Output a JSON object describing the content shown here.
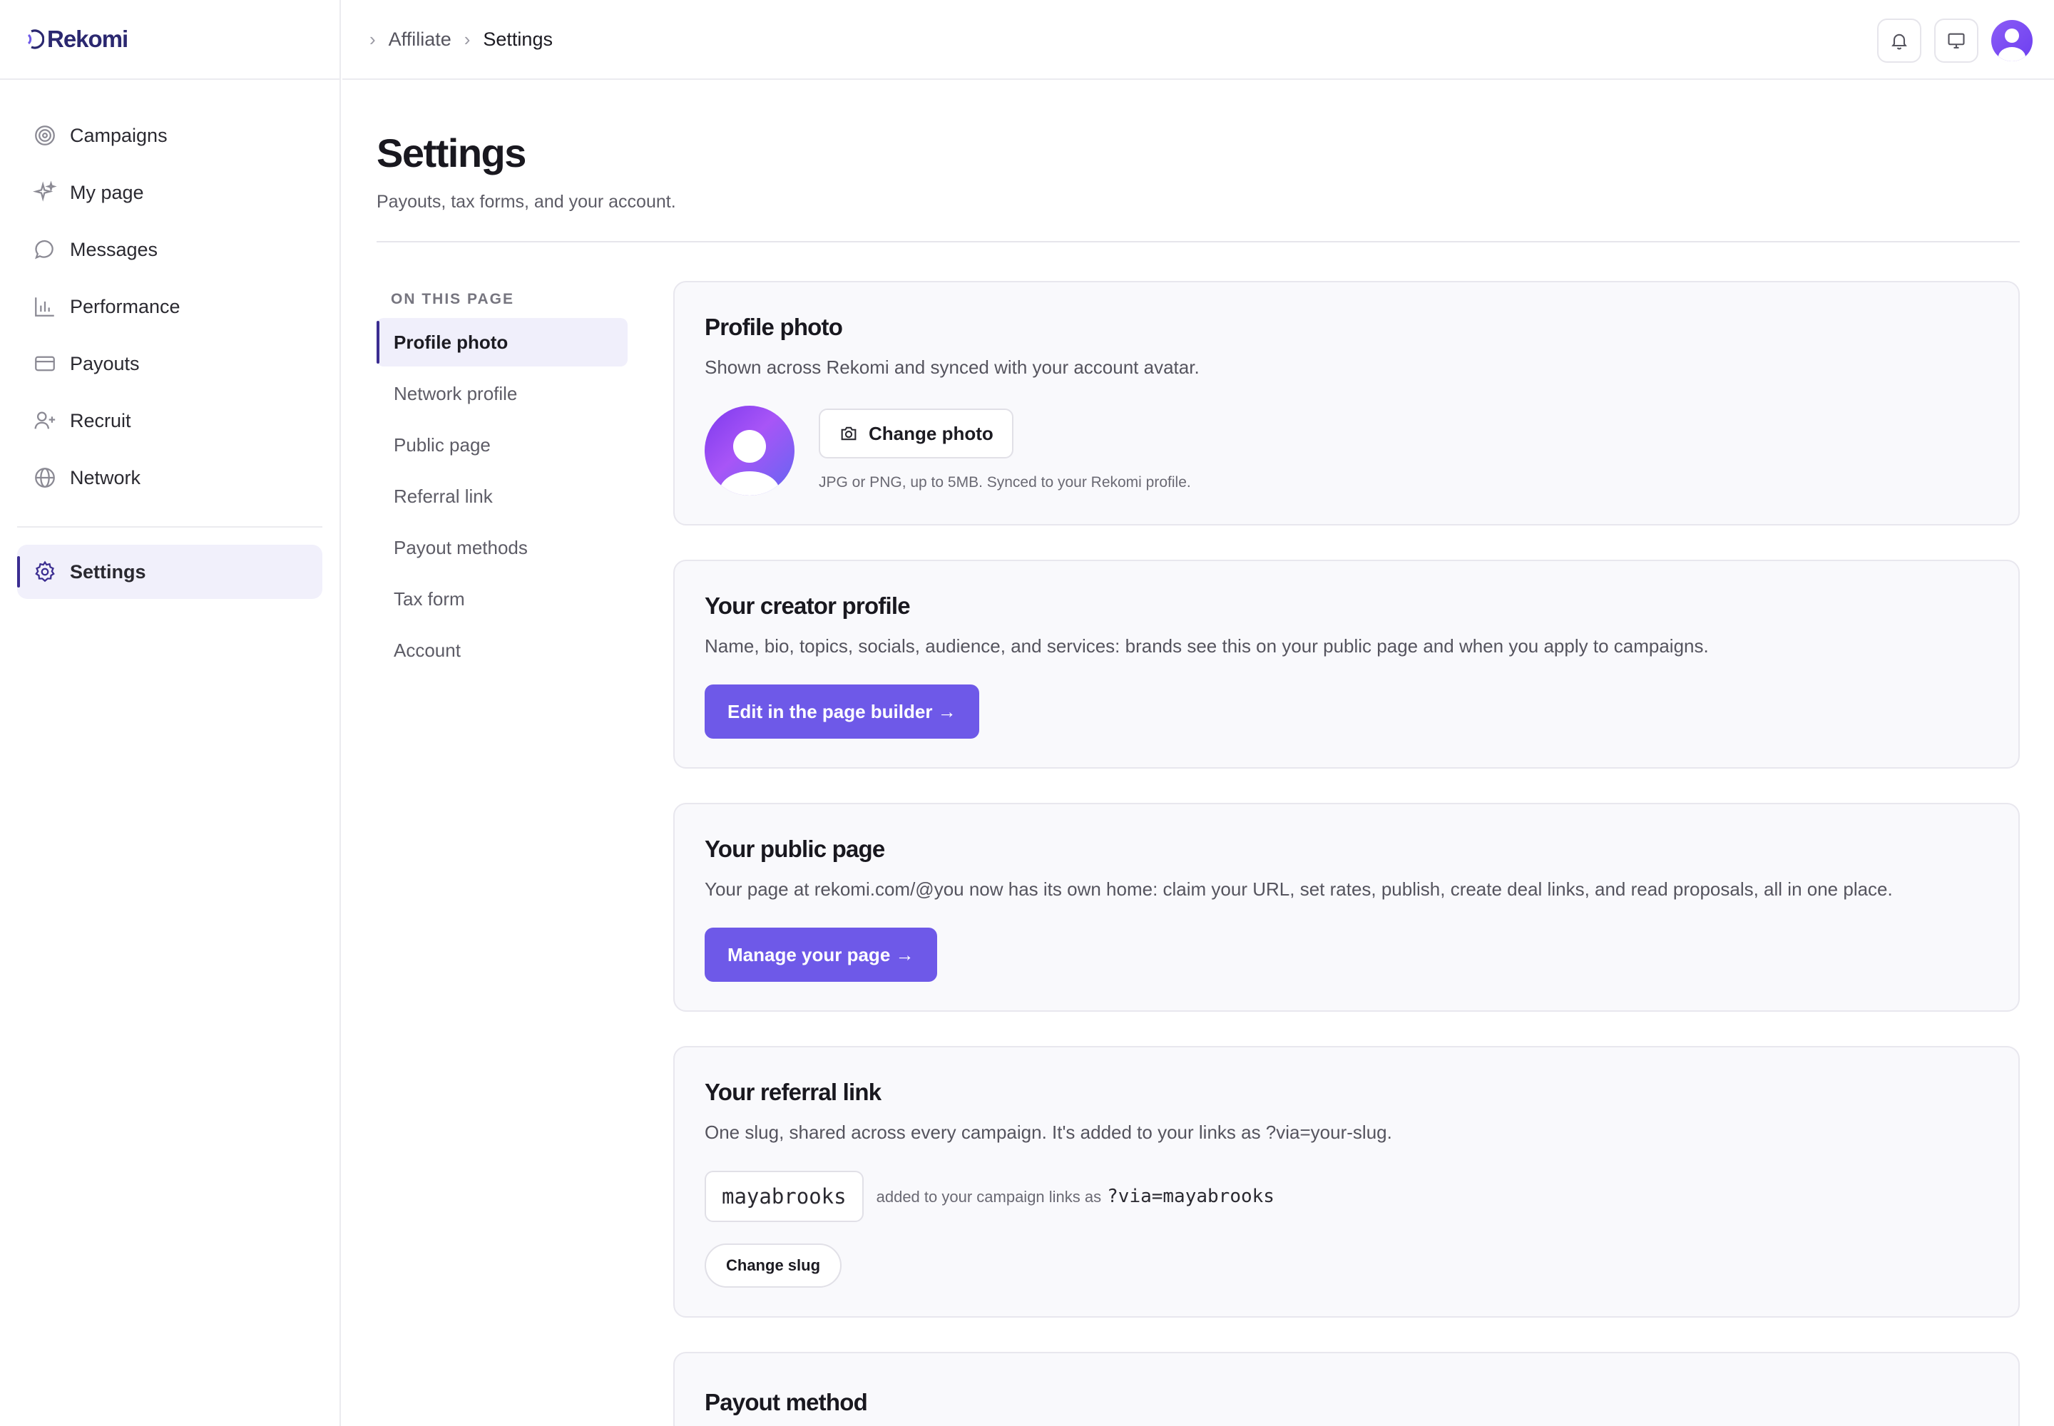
{
  "brand": {
    "name": "Rekomi"
  },
  "sidebar": {
    "items": [
      {
        "label": "Campaigns",
        "icon": "target-icon"
      },
      {
        "label": "My page",
        "icon": "sparkles-icon"
      },
      {
        "label": "Messages",
        "icon": "chat-bubble-icon"
      },
      {
        "label": "Performance",
        "icon": "bar-chart-icon"
      },
      {
        "label": "Payouts",
        "icon": "credit-card-icon"
      },
      {
        "label": "Recruit",
        "icon": "user-plus-icon"
      },
      {
        "label": "Network",
        "icon": "globe-icon"
      }
    ],
    "settings": {
      "label": "Settings",
      "icon": "gear-icon"
    }
  },
  "breadcrumb": {
    "parent": "Affiliate",
    "current": "Settings"
  },
  "page": {
    "title": "Settings",
    "subtitle": "Payouts, tax forms, and your account."
  },
  "toc": {
    "heading": "ON THIS PAGE",
    "items": [
      "Profile photo",
      "Network profile",
      "Public page",
      "Referral link",
      "Payout methods",
      "Tax form",
      "Account"
    ]
  },
  "profile_photo": {
    "title": "Profile photo",
    "description": "Shown across Rekomi and synced with your account avatar.",
    "change_label": "Change photo",
    "hint": "JPG or PNG, up to 5MB. Synced to your Rekomi profile."
  },
  "creator_profile": {
    "title": "Your creator profile",
    "description": "Name, bio, topics, socials, audience, and services: brands see this on your public page and when you apply to campaigns.",
    "button": "Edit in the page builder →"
  },
  "public_page": {
    "title": "Your public page",
    "description": "Your page at rekomi.com/@you now has its own home: claim your URL, set rates, publish, create deal links, and read proposals, all in one place.",
    "button": "Manage your page →"
  },
  "referral": {
    "title": "Your referral link",
    "description": "One slug, shared across every campaign. It's added to your links as ?via=your-slug.",
    "slug": "mayabrooks",
    "note": "added to your campaign links as",
    "param": "?via=mayabrooks",
    "button": "Change slug"
  },
  "payout": {
    "title": "Payout method"
  },
  "colors": {
    "accent": "#6e59e8",
    "active_bar": "#3b2d91",
    "brand": "#2b2870"
  }
}
